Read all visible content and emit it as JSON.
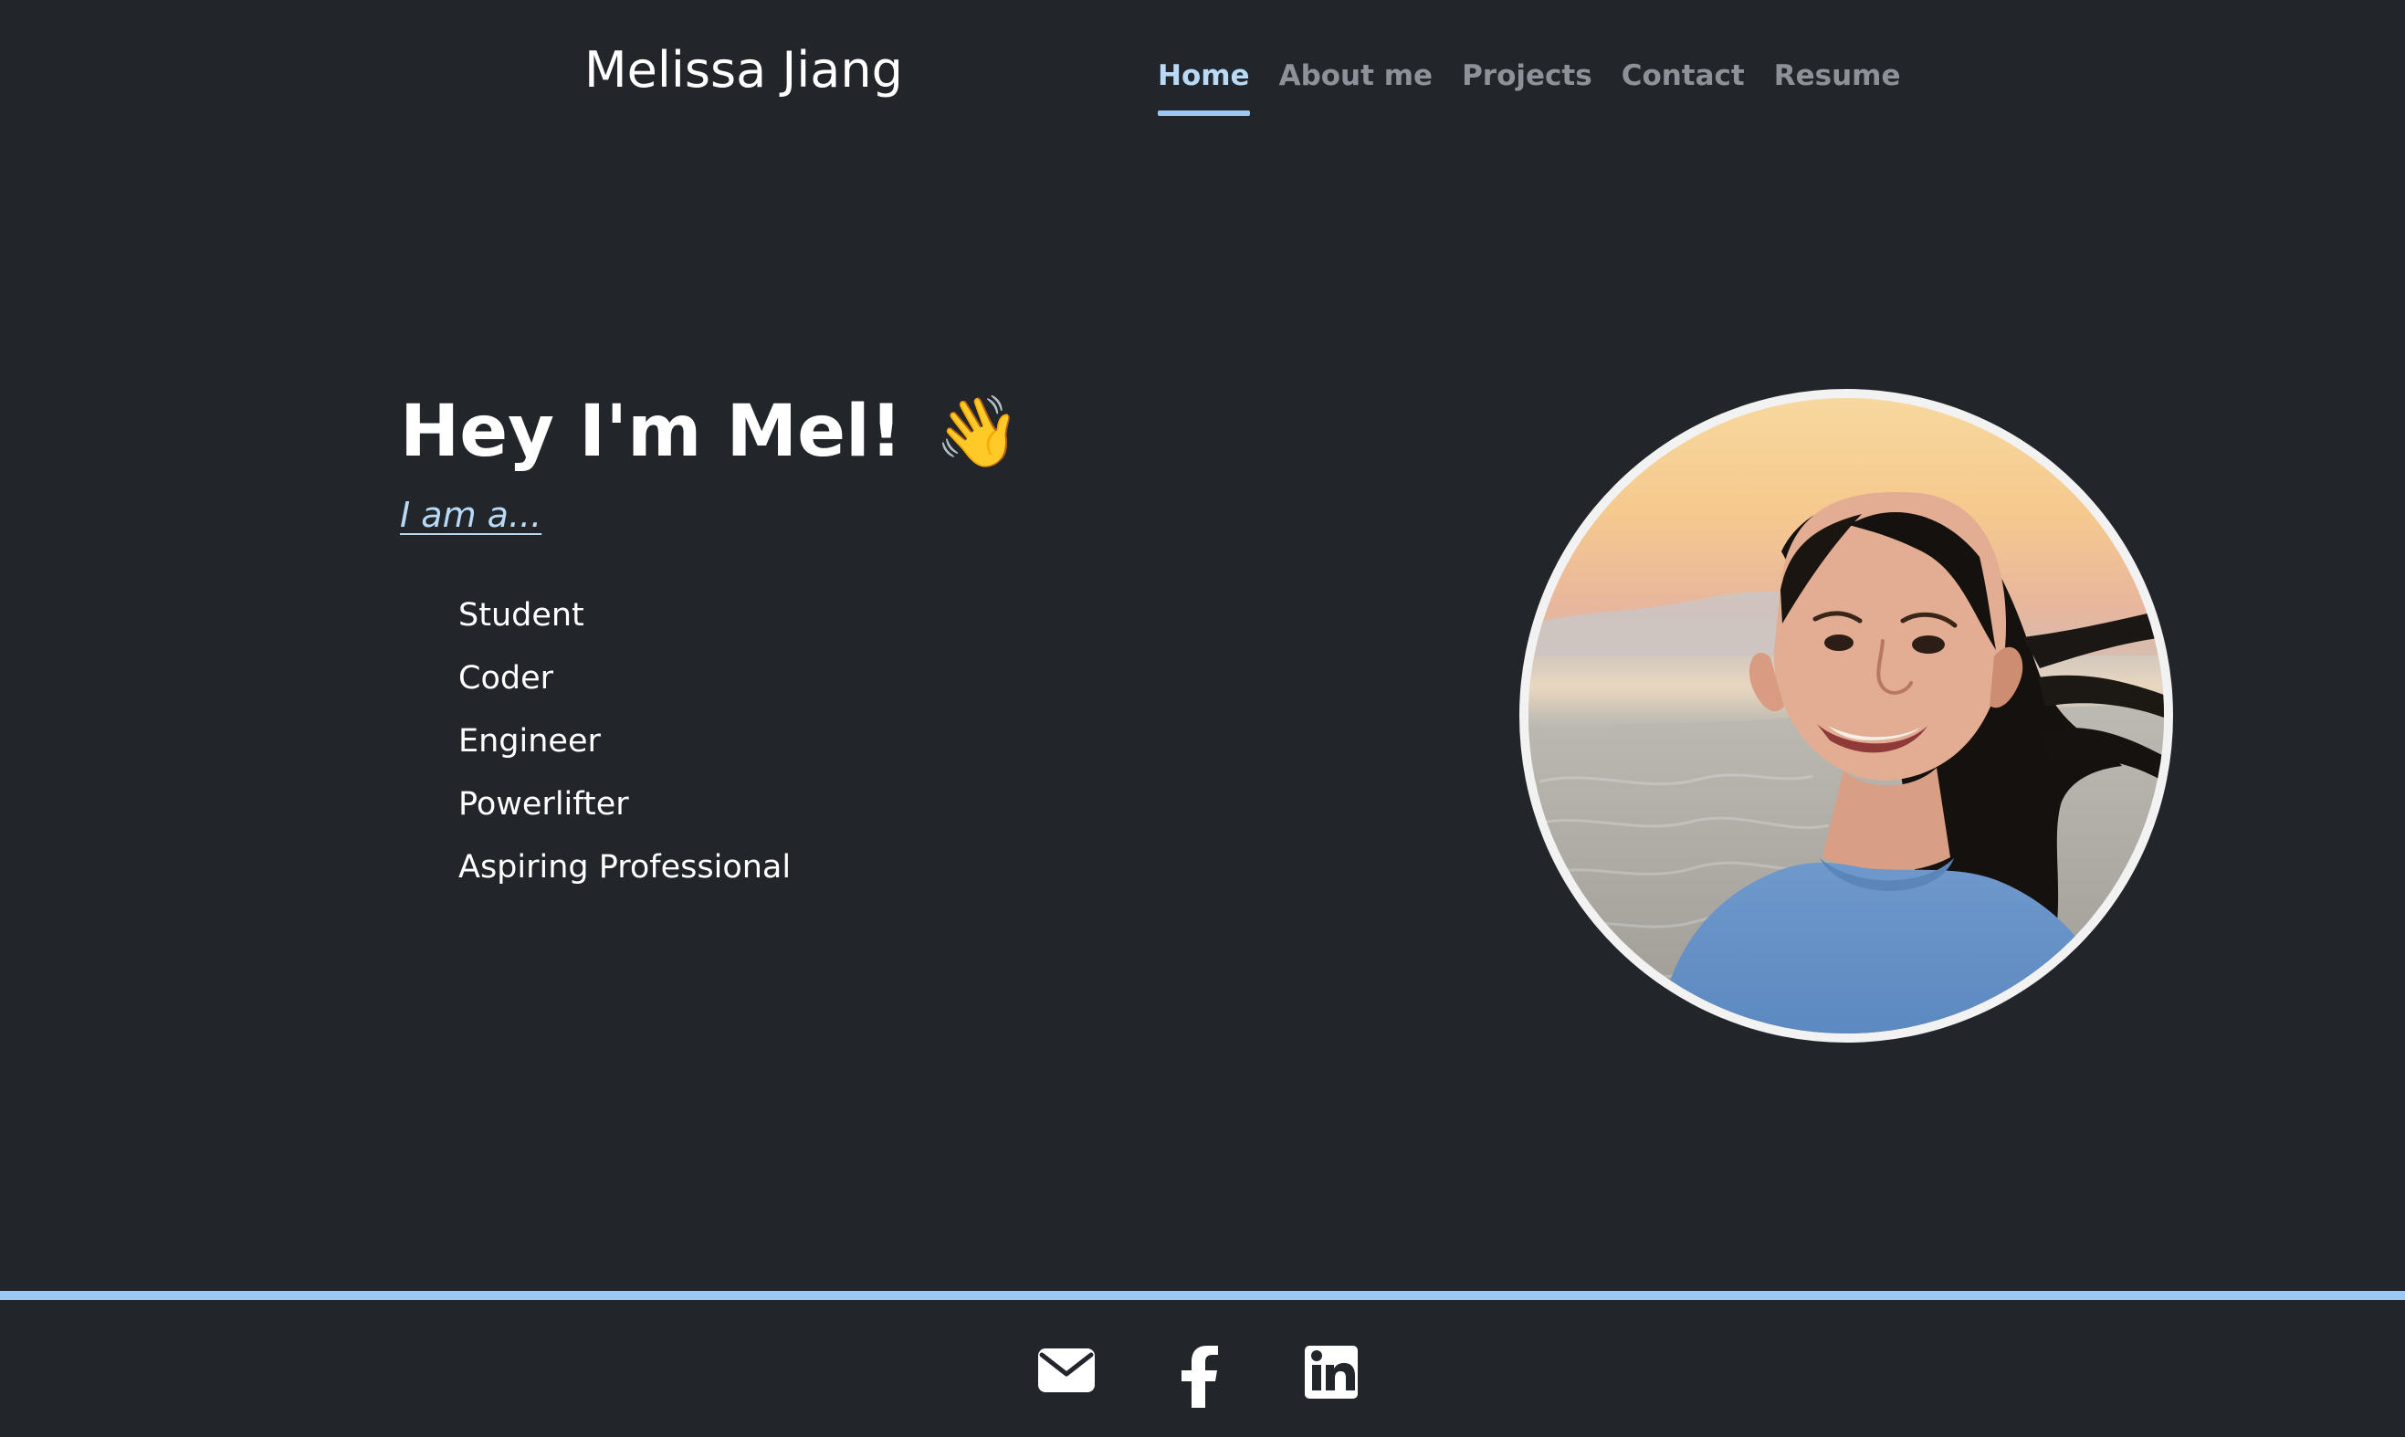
{
  "header": {
    "site_title": "Melissa Jiang",
    "nav_items": [
      {
        "label": "Home",
        "active": true
      },
      {
        "label": "About me",
        "active": false
      },
      {
        "label": "Projects",
        "active": false
      },
      {
        "label": "Contact",
        "active": false
      },
      {
        "label": "Resume",
        "active": false
      }
    ]
  },
  "hero": {
    "heading": "Hey I'm Mel!",
    "emoji": "👋",
    "subheading": "I am a...",
    "roles": [
      "Student",
      "Coder",
      "Engineer",
      "Powerlifter",
      "Aspiring Professional"
    ],
    "photo": "profile-photo"
  },
  "footer": {
    "icons": [
      "email-icon",
      "facebook-icon",
      "linkedin-icon"
    ]
  },
  "colors": {
    "background": "#22252a",
    "accent": "#9cc9f3",
    "active_nav_text": "#b8daf7",
    "inactive_nav_text": "#8e9198",
    "text": "#ffffff"
  }
}
